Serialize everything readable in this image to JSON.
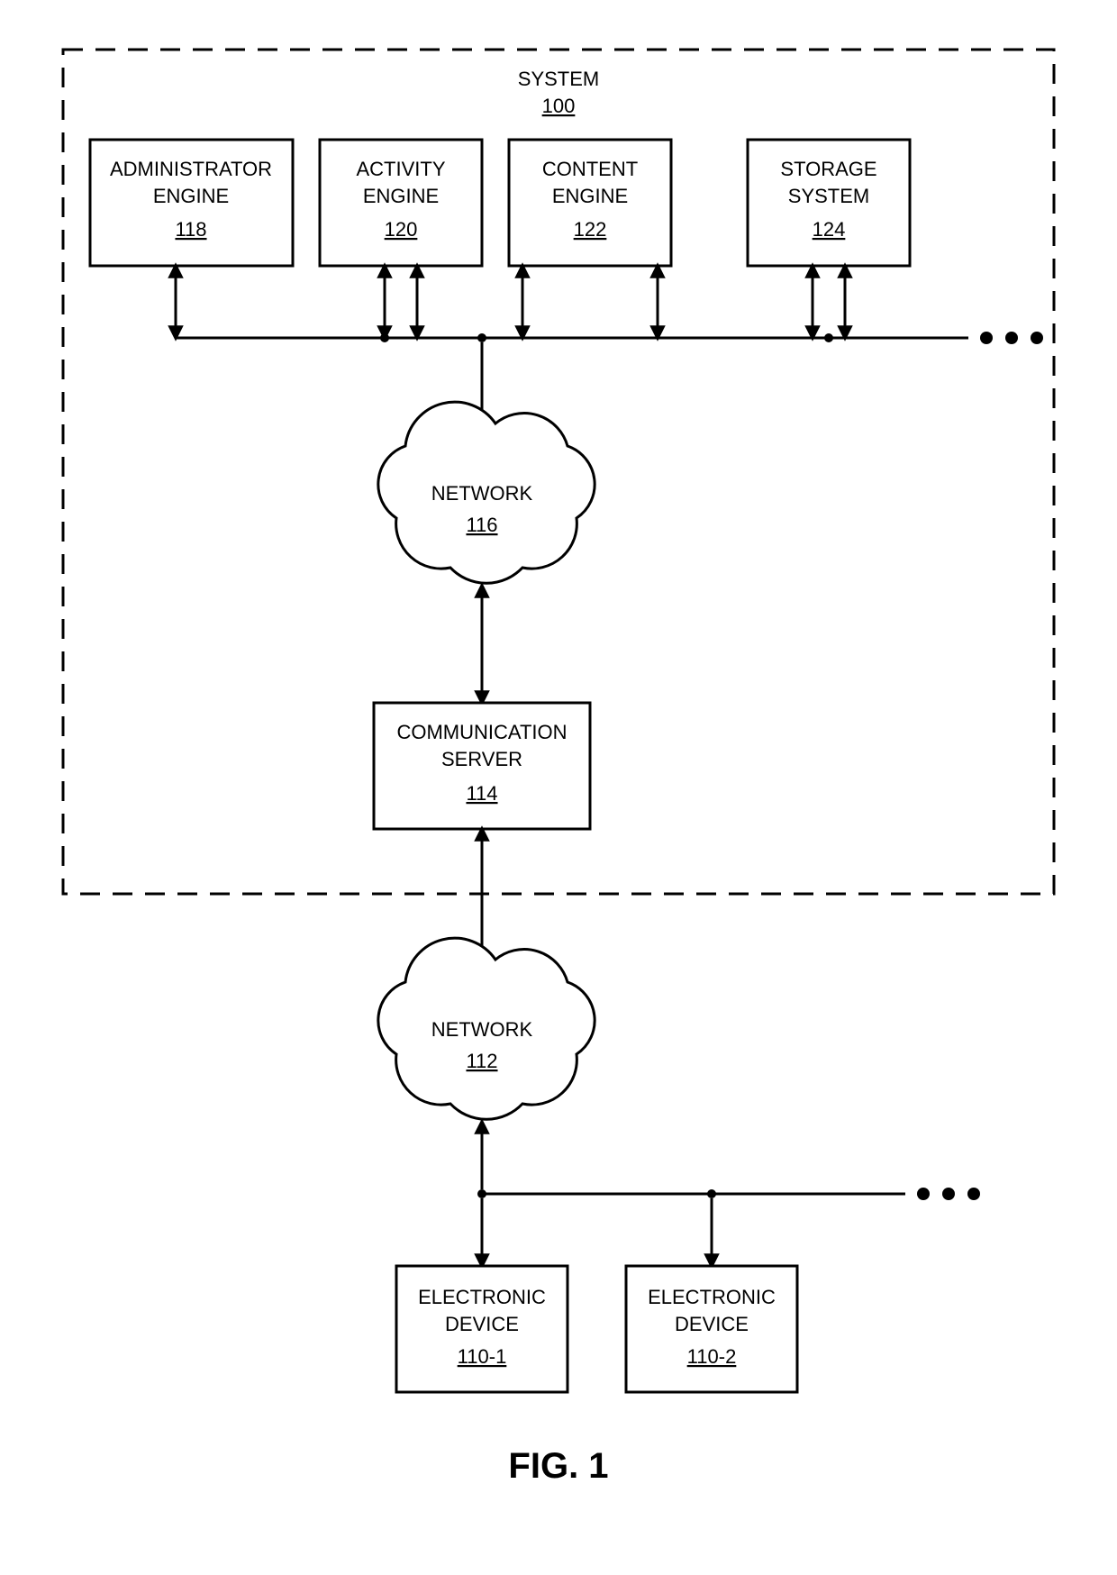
{
  "figure": {
    "title": "FIG. 1"
  },
  "system": {
    "label": "SYSTEM",
    "ref": "100"
  },
  "blocks": {
    "admin": {
      "label1": "ADMINISTRATOR",
      "label2": "ENGINE",
      "ref": "118"
    },
    "activity": {
      "label1": "ACTIVITY",
      "label2": "ENGINE",
      "ref": "120"
    },
    "content": {
      "label1": "CONTENT",
      "label2": "ENGINE",
      "ref": "122"
    },
    "storage": {
      "label1": "STORAGE",
      "label2": "SYSTEM",
      "ref": "124"
    },
    "network_top": {
      "label": "NETWORK",
      "ref": "116"
    },
    "comm_server": {
      "label1": "COMMUNICATION",
      "label2": "SERVER",
      "ref": "114"
    },
    "network_bottom": {
      "label": "NETWORK",
      "ref": "112"
    },
    "device1": {
      "label1": "ELECTRONIC",
      "label2": "DEVICE",
      "ref": "110-1"
    },
    "device2": {
      "label1": "ELECTRONIC",
      "label2": "DEVICE",
      "ref": "110-2"
    }
  },
  "ellipsis": "..."
}
